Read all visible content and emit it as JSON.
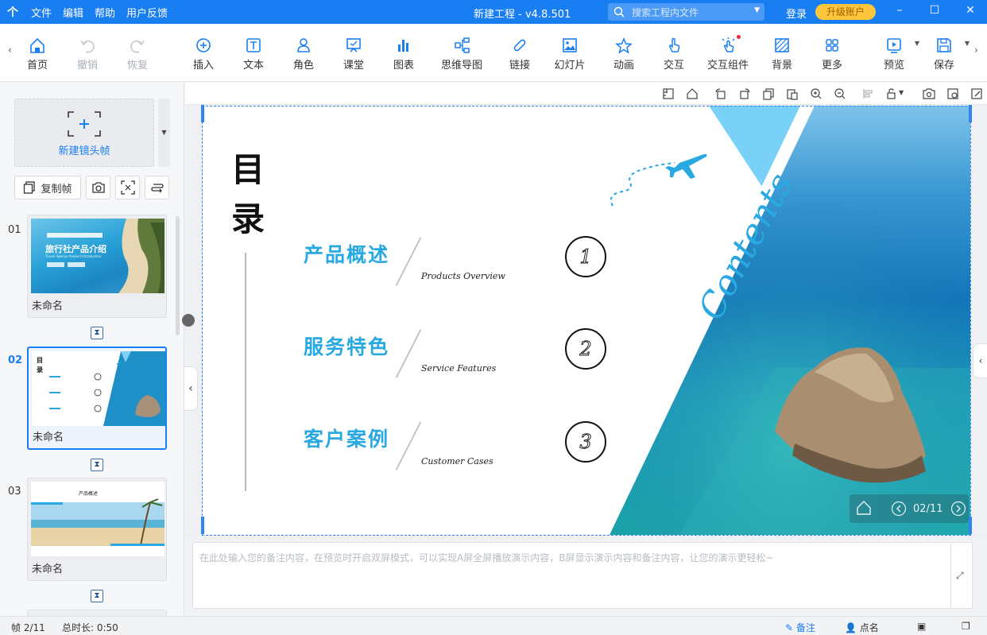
{
  "titlebar": {
    "logo": "个",
    "menu": [
      "文件",
      "编辑",
      "帮助",
      "用户反馈"
    ],
    "title": "新建工程 - v4.8.501",
    "search_placeholder": "搜索工程内文件",
    "login": "登录",
    "upgrade": "升级账户"
  },
  "toolbar": {
    "items": [
      {
        "label": "首页",
        "icon": "home-icon"
      },
      {
        "label": "撤销",
        "icon": "undo-icon"
      },
      {
        "label": "恢复",
        "icon": "redo-icon"
      },
      {
        "label": "插入",
        "icon": "insert-plus-icon"
      },
      {
        "label": "文本",
        "icon": "text-icon"
      },
      {
        "label": "角色",
        "icon": "character-icon"
      },
      {
        "label": "课堂",
        "icon": "classroom-icon"
      },
      {
        "label": "图表",
        "icon": "chart-icon"
      },
      {
        "label": "思维导图",
        "icon": "mindmap-icon"
      },
      {
        "label": "链接",
        "icon": "link-icon"
      },
      {
        "label": "幻灯片",
        "icon": "slideshow-icon"
      },
      {
        "label": "动画",
        "icon": "animation-star-icon"
      },
      {
        "label": "交互",
        "icon": "interact-hand-icon"
      },
      {
        "label": "交互组件",
        "icon": "interactive-widget-icon"
      },
      {
        "label": "背景",
        "icon": "background-icon"
      },
      {
        "label": "更多",
        "icon": "more-grid-icon"
      },
      {
        "label": "预览",
        "icon": "preview-icon"
      },
      {
        "label": "保存",
        "icon": "save-icon"
      }
    ]
  },
  "leftpanel": {
    "new_frame": "新建镜头帧",
    "copy_frame": "复制帧",
    "thumbnails": [
      {
        "num": "01",
        "caption": "未命名",
        "title": "旅行社产品介绍",
        "subtitle": "Travel Agency Product Introduction"
      },
      {
        "num": "02",
        "caption": "未命名"
      },
      {
        "num": "03",
        "caption": "未命名",
        "title": "产品概述"
      }
    ]
  },
  "slide": {
    "title": "目录",
    "contents": "Contents",
    "items": [
      {
        "zh": "产品概述",
        "en": "Products Overview",
        "num": "1"
      },
      {
        "zh": "服务特色",
        "en": "Service Features",
        "num": "2"
      },
      {
        "zh": "客户案例",
        "en": "Customer Cases",
        "num": "3"
      }
    ],
    "page_indicator": "02/11"
  },
  "notes": {
    "placeholder": "在此处输入您的备注内容，在预览时开启双屏模式，可以实现A屏全屏播放演示内容，B屏显示演示内容和备注内容，让您的演示更轻松~"
  },
  "statusbar": {
    "frame": "帧 2/11",
    "duration": "总时长: 0:50",
    "notes": "备注",
    "rollcall": "点名"
  },
  "colors": {
    "accent": "#1a7ef3",
    "slide_cyan": "#29a9e1",
    "upgrade": "#ffc63b"
  }
}
